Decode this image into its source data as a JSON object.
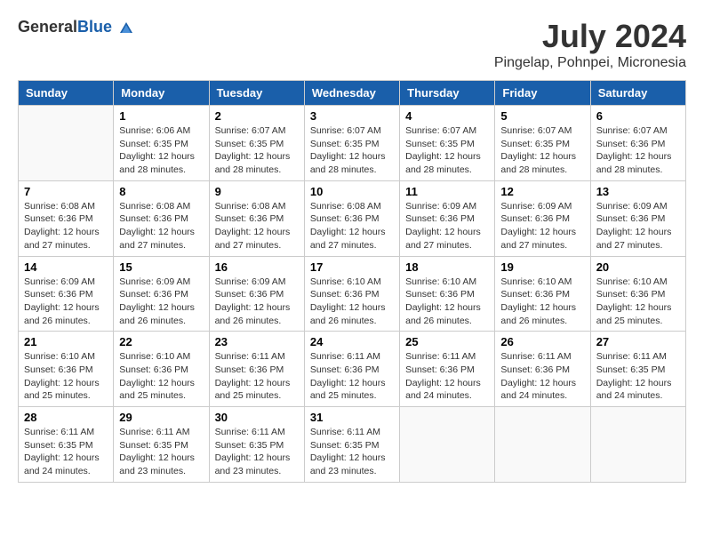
{
  "header": {
    "logo_general": "General",
    "logo_blue": "Blue",
    "month_year": "July 2024",
    "location": "Pingelap, Pohnpei, Micronesia"
  },
  "weekdays": [
    "Sunday",
    "Monday",
    "Tuesday",
    "Wednesday",
    "Thursday",
    "Friday",
    "Saturday"
  ],
  "weeks": [
    [
      {
        "day": "",
        "info": ""
      },
      {
        "day": "1",
        "info": "Sunrise: 6:06 AM\nSunset: 6:35 PM\nDaylight: 12 hours\nand 28 minutes."
      },
      {
        "day": "2",
        "info": "Sunrise: 6:07 AM\nSunset: 6:35 PM\nDaylight: 12 hours\nand 28 minutes."
      },
      {
        "day": "3",
        "info": "Sunrise: 6:07 AM\nSunset: 6:35 PM\nDaylight: 12 hours\nand 28 minutes."
      },
      {
        "day": "4",
        "info": "Sunrise: 6:07 AM\nSunset: 6:35 PM\nDaylight: 12 hours\nand 28 minutes."
      },
      {
        "day": "5",
        "info": "Sunrise: 6:07 AM\nSunset: 6:35 PM\nDaylight: 12 hours\nand 28 minutes."
      },
      {
        "day": "6",
        "info": "Sunrise: 6:07 AM\nSunset: 6:36 PM\nDaylight: 12 hours\nand 28 minutes."
      }
    ],
    [
      {
        "day": "7",
        "info": "Sunrise: 6:08 AM\nSunset: 6:36 PM\nDaylight: 12 hours\nand 27 minutes."
      },
      {
        "day": "8",
        "info": "Sunrise: 6:08 AM\nSunset: 6:36 PM\nDaylight: 12 hours\nand 27 minutes."
      },
      {
        "day": "9",
        "info": "Sunrise: 6:08 AM\nSunset: 6:36 PM\nDaylight: 12 hours\nand 27 minutes."
      },
      {
        "day": "10",
        "info": "Sunrise: 6:08 AM\nSunset: 6:36 PM\nDaylight: 12 hours\nand 27 minutes."
      },
      {
        "day": "11",
        "info": "Sunrise: 6:09 AM\nSunset: 6:36 PM\nDaylight: 12 hours\nand 27 minutes."
      },
      {
        "day": "12",
        "info": "Sunrise: 6:09 AM\nSunset: 6:36 PM\nDaylight: 12 hours\nand 27 minutes."
      },
      {
        "day": "13",
        "info": "Sunrise: 6:09 AM\nSunset: 6:36 PM\nDaylight: 12 hours\nand 27 minutes."
      }
    ],
    [
      {
        "day": "14",
        "info": "Sunrise: 6:09 AM\nSunset: 6:36 PM\nDaylight: 12 hours\nand 26 minutes."
      },
      {
        "day": "15",
        "info": "Sunrise: 6:09 AM\nSunset: 6:36 PM\nDaylight: 12 hours\nand 26 minutes."
      },
      {
        "day": "16",
        "info": "Sunrise: 6:09 AM\nSunset: 6:36 PM\nDaylight: 12 hours\nand 26 minutes."
      },
      {
        "day": "17",
        "info": "Sunrise: 6:10 AM\nSunset: 6:36 PM\nDaylight: 12 hours\nand 26 minutes."
      },
      {
        "day": "18",
        "info": "Sunrise: 6:10 AM\nSunset: 6:36 PM\nDaylight: 12 hours\nand 26 minutes."
      },
      {
        "day": "19",
        "info": "Sunrise: 6:10 AM\nSunset: 6:36 PM\nDaylight: 12 hours\nand 26 minutes."
      },
      {
        "day": "20",
        "info": "Sunrise: 6:10 AM\nSunset: 6:36 PM\nDaylight: 12 hours\nand 25 minutes."
      }
    ],
    [
      {
        "day": "21",
        "info": "Sunrise: 6:10 AM\nSunset: 6:36 PM\nDaylight: 12 hours\nand 25 minutes."
      },
      {
        "day": "22",
        "info": "Sunrise: 6:10 AM\nSunset: 6:36 PM\nDaylight: 12 hours\nand 25 minutes."
      },
      {
        "day": "23",
        "info": "Sunrise: 6:11 AM\nSunset: 6:36 PM\nDaylight: 12 hours\nand 25 minutes."
      },
      {
        "day": "24",
        "info": "Sunrise: 6:11 AM\nSunset: 6:36 PM\nDaylight: 12 hours\nand 25 minutes."
      },
      {
        "day": "25",
        "info": "Sunrise: 6:11 AM\nSunset: 6:36 PM\nDaylight: 12 hours\nand 24 minutes."
      },
      {
        "day": "26",
        "info": "Sunrise: 6:11 AM\nSunset: 6:36 PM\nDaylight: 12 hours\nand 24 minutes."
      },
      {
        "day": "27",
        "info": "Sunrise: 6:11 AM\nSunset: 6:35 PM\nDaylight: 12 hours\nand 24 minutes."
      }
    ],
    [
      {
        "day": "28",
        "info": "Sunrise: 6:11 AM\nSunset: 6:35 PM\nDaylight: 12 hours\nand 24 minutes."
      },
      {
        "day": "29",
        "info": "Sunrise: 6:11 AM\nSunset: 6:35 PM\nDaylight: 12 hours\nand 23 minutes."
      },
      {
        "day": "30",
        "info": "Sunrise: 6:11 AM\nSunset: 6:35 PM\nDaylight: 12 hours\nand 23 minutes."
      },
      {
        "day": "31",
        "info": "Sunrise: 6:11 AM\nSunset: 6:35 PM\nDaylight: 12 hours\nand 23 minutes."
      },
      {
        "day": "",
        "info": ""
      },
      {
        "day": "",
        "info": ""
      },
      {
        "day": "",
        "info": ""
      }
    ]
  ]
}
